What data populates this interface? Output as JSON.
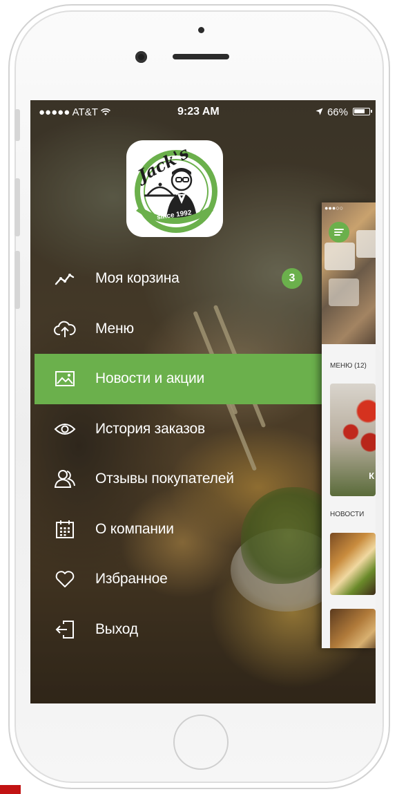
{
  "status_bar": {
    "carrier": "●●●●● AT&T",
    "time": "9:23 AM",
    "battery": "66%"
  },
  "logo": {
    "brand": "Jack's",
    "since": "since 1992"
  },
  "menu": [
    {
      "label": "Моя корзина",
      "icon": "trend-line-icon",
      "badge": "3",
      "active": false
    },
    {
      "label": "Меню",
      "icon": "cloud-upload-icon",
      "active": false
    },
    {
      "label": "Новости и акции",
      "icon": "image-icon",
      "active": true
    },
    {
      "label": "История заказов",
      "icon": "eye-icon",
      "active": false
    },
    {
      "label": "Отзывы покупателей",
      "icon": "users-icon",
      "active": false
    },
    {
      "label": "О компании",
      "icon": "calendar-icon",
      "active": false
    },
    {
      "label": "Избранное",
      "icon": "heart-icon",
      "active": false
    },
    {
      "label": "Выход",
      "icon": "logout-icon",
      "active": false
    }
  ],
  "preview": {
    "menu_section": "МЕНЮ (12)",
    "news_section": "НОВОСТИ",
    "card_letter": "К"
  },
  "colors": {
    "accent": "#6bb04c",
    "screen_bg": "#3a2e22"
  }
}
